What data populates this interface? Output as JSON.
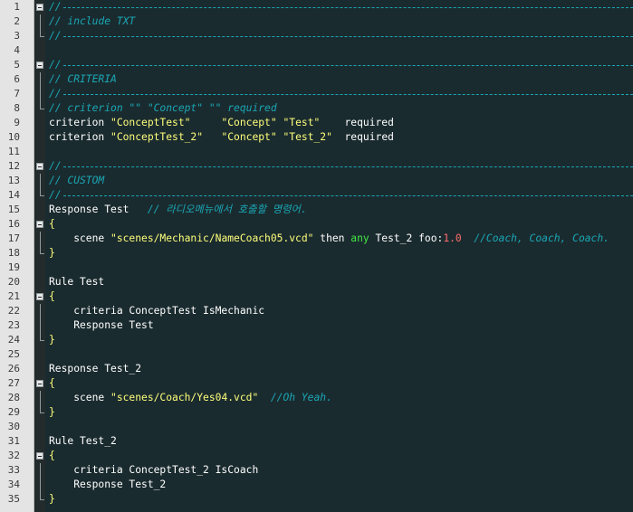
{
  "lines": [
    {
      "n": "1",
      "parts": [
        {
          "t": "//",
          "c": "com",
          "dash": true
        }
      ],
      "fold": "open"
    },
    {
      "n": "2",
      "parts": [
        {
          "t": "// include TXT",
          "c": "com"
        }
      ],
      "fold": "mid"
    },
    {
      "n": "3",
      "parts": [
        {
          "t": "//",
          "c": "com",
          "dash": true
        }
      ],
      "fold": "end"
    },
    {
      "n": "4",
      "parts": [],
      "fold": "none"
    },
    {
      "n": "5",
      "parts": [
        {
          "t": "//",
          "c": "com",
          "dash": true
        }
      ],
      "fold": "open"
    },
    {
      "n": "6",
      "parts": [
        {
          "t": "// CRITERIA",
          "c": "com"
        }
      ],
      "fold": "mid"
    },
    {
      "n": "7",
      "parts": [
        {
          "t": "//",
          "c": "com",
          "dash": true
        }
      ],
      "fold": "mid"
    },
    {
      "n": "8",
      "parts": [
        {
          "t": "// criterion \"\" \"Concept\" \"\" required",
          "c": "com"
        }
      ],
      "fold": "end"
    },
    {
      "n": "9",
      "parts": [
        {
          "t": "criterion ",
          "c": "kw"
        },
        {
          "t": "\"ConceptTest\"",
          "c": "str"
        },
        {
          "t": "     ",
          "c": "kw"
        },
        {
          "t": "\"Concept\"",
          "c": "str"
        },
        {
          "t": " ",
          "c": "kw"
        },
        {
          "t": "\"Test\"",
          "c": "str"
        },
        {
          "t": "    required",
          "c": "kw"
        }
      ],
      "fold": "none"
    },
    {
      "n": "10",
      "parts": [
        {
          "t": "criterion ",
          "c": "kw"
        },
        {
          "t": "\"ConceptTest_2\"",
          "c": "str"
        },
        {
          "t": "   ",
          "c": "kw"
        },
        {
          "t": "\"Concept\"",
          "c": "str"
        },
        {
          "t": " ",
          "c": "kw"
        },
        {
          "t": "\"Test_2\"",
          "c": "str"
        },
        {
          "t": "  required",
          "c": "kw"
        }
      ],
      "fold": "none"
    },
    {
      "n": "11",
      "parts": [],
      "fold": "none"
    },
    {
      "n": "12",
      "parts": [
        {
          "t": "//",
          "c": "com",
          "dash": true
        }
      ],
      "fold": "open"
    },
    {
      "n": "13",
      "parts": [
        {
          "t": "// CUSTOM",
          "c": "com"
        }
      ],
      "fold": "mid"
    },
    {
      "n": "14",
      "parts": [
        {
          "t": "//",
          "c": "com",
          "dash": true
        }
      ],
      "fold": "end"
    },
    {
      "n": "15",
      "parts": [
        {
          "t": "Response Test   ",
          "c": "kw"
        },
        {
          "t": "// 라디오메뉴에서 호출할 명령어.",
          "c": "com"
        }
      ],
      "fold": "none"
    },
    {
      "n": "16",
      "parts": [
        {
          "t": "{",
          "c": "brace"
        }
      ],
      "fold": "open"
    },
    {
      "n": "17",
      "parts": [
        {
          "t": "    scene ",
          "c": "kw"
        },
        {
          "t": "\"scenes/Mechanic/NameCoach05.vcd\"",
          "c": "str"
        },
        {
          "t": " then ",
          "c": "kw"
        },
        {
          "t": "any",
          "c": "green"
        },
        {
          "t": " Test_2 foo:",
          "c": "kw"
        },
        {
          "t": "1.0",
          "c": "num"
        },
        {
          "t": "  ",
          "c": "kw"
        },
        {
          "t": "//Coach, Coach, Coach.",
          "c": "com"
        }
      ],
      "fold": "mid"
    },
    {
      "n": "18",
      "parts": [
        {
          "t": "}",
          "c": "brace"
        }
      ],
      "fold": "end"
    },
    {
      "n": "19",
      "parts": [],
      "fold": "none"
    },
    {
      "n": "20",
      "parts": [
        {
          "t": "Rule Test",
          "c": "kw"
        }
      ],
      "fold": "none"
    },
    {
      "n": "21",
      "parts": [
        {
          "t": "{",
          "c": "brace"
        }
      ],
      "fold": "open"
    },
    {
      "n": "22",
      "parts": [
        {
          "t": "    criteria ConceptTest IsMechanic",
          "c": "kw"
        }
      ],
      "fold": "mid"
    },
    {
      "n": "23",
      "parts": [
        {
          "t": "    Response Test",
          "c": "kw"
        }
      ],
      "fold": "mid"
    },
    {
      "n": "24",
      "parts": [
        {
          "t": "}",
          "c": "brace"
        }
      ],
      "fold": "end"
    },
    {
      "n": "25",
      "parts": [],
      "fold": "none"
    },
    {
      "n": "26",
      "parts": [
        {
          "t": "Response Test_2",
          "c": "kw"
        }
      ],
      "fold": "none"
    },
    {
      "n": "27",
      "parts": [
        {
          "t": "{",
          "c": "brace"
        }
      ],
      "fold": "open"
    },
    {
      "n": "28",
      "parts": [
        {
          "t": "    scene ",
          "c": "kw"
        },
        {
          "t": "\"scenes/Coach/Yes04.vcd\"",
          "c": "str"
        },
        {
          "t": "  ",
          "c": "kw"
        },
        {
          "t": "//Oh Yeah.",
          "c": "com"
        }
      ],
      "fold": "mid"
    },
    {
      "n": "29",
      "parts": [
        {
          "t": "}",
          "c": "brace"
        }
      ],
      "fold": "end"
    },
    {
      "n": "30",
      "parts": [],
      "fold": "none"
    },
    {
      "n": "31",
      "parts": [
        {
          "t": "Rule Test_2",
          "c": "kw"
        }
      ],
      "fold": "none"
    },
    {
      "n": "32",
      "parts": [
        {
          "t": "{",
          "c": "brace"
        }
      ],
      "fold": "open"
    },
    {
      "n": "33",
      "parts": [
        {
          "t": "    criteria ConceptTest_2 IsCoach",
          "c": "kw"
        }
      ],
      "fold": "mid"
    },
    {
      "n": "34",
      "parts": [
        {
          "t": "    Response Test_2",
          "c": "kw"
        }
      ],
      "fold": "mid"
    },
    {
      "n": "35",
      "parts": [
        {
          "t": "}",
          "c": "brace"
        }
      ],
      "fold": "end"
    }
  ],
  "colors": {
    "background": "#1a2b2f",
    "comment": "#1aa7b5",
    "string": "#ffff7a",
    "keyword": "#ffffff",
    "any": "#41e641",
    "number": "#ff6b6b"
  }
}
